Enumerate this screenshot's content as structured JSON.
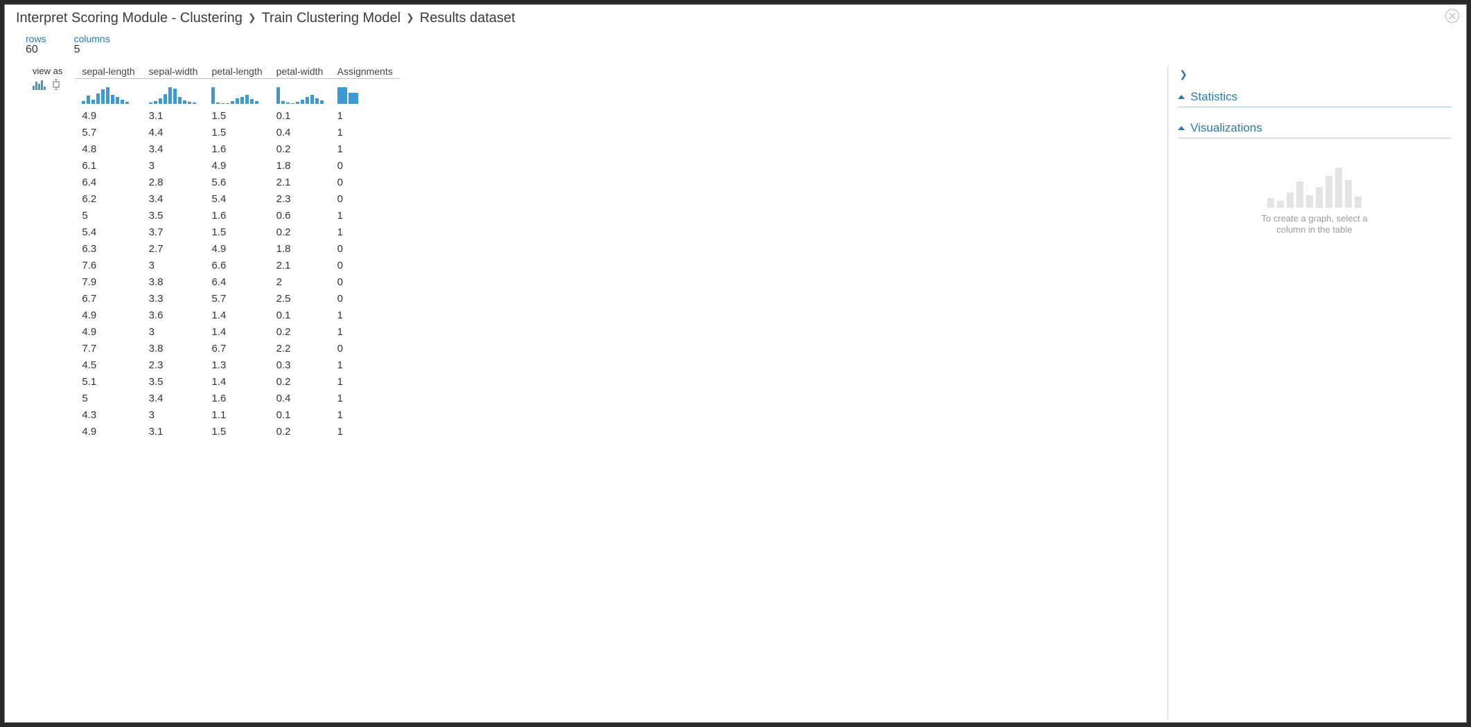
{
  "breadcrumb": {
    "level1": "Interpret Scoring Module - Clustering",
    "level2": "Train Clustering Model",
    "level3": "Results dataset"
  },
  "meta": {
    "rows_label": "rows",
    "rows_value": "60",
    "columns_label": "columns",
    "columns_value": "5"
  },
  "viewas": {
    "label": "view as"
  },
  "table": {
    "columns": [
      "sepal-length",
      "sepal-width",
      "petal-length",
      "petal-width",
      "Assignments"
    ],
    "histograms": [
      [
        4,
        12,
        6,
        16,
        22,
        25,
        14,
        10,
        6,
        3
      ],
      [
        2,
        4,
        8,
        14,
        24,
        22,
        10,
        5,
        3,
        2
      ],
      [
        25,
        2,
        1,
        0,
        4,
        8,
        10,
        14,
        7,
        4
      ],
      [
        25,
        4,
        2,
        0,
        3,
        6,
        10,
        14,
        8,
        5
      ],
      [
        60,
        40
      ]
    ],
    "rows": [
      [
        "4.9",
        "3.1",
        "1.5",
        "0.1",
        "1"
      ],
      [
        "5.7",
        "4.4",
        "1.5",
        "0.4",
        "1"
      ],
      [
        "4.8",
        "3.4",
        "1.6",
        "0.2",
        "1"
      ],
      [
        "6.1",
        "3",
        "4.9",
        "1.8",
        "0"
      ],
      [
        "6.4",
        "2.8",
        "5.6",
        "2.1",
        "0"
      ],
      [
        "6.2",
        "3.4",
        "5.4",
        "2.3",
        "0"
      ],
      [
        "5",
        "3.5",
        "1.6",
        "0.6",
        "1"
      ],
      [
        "5.4",
        "3.7",
        "1.5",
        "0.2",
        "1"
      ],
      [
        "6.3",
        "2.7",
        "4.9",
        "1.8",
        "0"
      ],
      [
        "7.6",
        "3",
        "6.6",
        "2.1",
        "0"
      ],
      [
        "7.9",
        "3.8",
        "6.4",
        "2",
        "0"
      ],
      [
        "6.7",
        "3.3",
        "5.7",
        "2.5",
        "0"
      ],
      [
        "4.9",
        "3.6",
        "1.4",
        "0.1",
        "1"
      ],
      [
        "4.9",
        "3",
        "1.4",
        "0.2",
        "1"
      ],
      [
        "7.7",
        "3.8",
        "6.7",
        "2.2",
        "0"
      ],
      [
        "4.5",
        "2.3",
        "1.3",
        "0.3",
        "1"
      ],
      [
        "5.1",
        "3.5",
        "1.4",
        "0.2",
        "1"
      ],
      [
        "5",
        "3.4",
        "1.6",
        "0.4",
        "1"
      ],
      [
        "4.3",
        "3",
        "1.1",
        "0.1",
        "1"
      ],
      [
        "4.9",
        "3.1",
        "1.5",
        "0.2",
        "1"
      ]
    ]
  },
  "rightpane": {
    "statistics_label": "Statistics",
    "visualizations_label": "Visualizations",
    "placeholder_line1": "To create a graph, select a",
    "placeholder_line2": "column in the table"
  },
  "chart_data": [
    {
      "type": "bar",
      "title": "sepal-length distribution",
      "values": [
        4,
        12,
        6,
        16,
        22,
        25,
        14,
        10,
        6,
        3
      ]
    },
    {
      "type": "bar",
      "title": "sepal-width distribution",
      "values": [
        2,
        4,
        8,
        14,
        24,
        22,
        10,
        5,
        3,
        2
      ]
    },
    {
      "type": "bar",
      "title": "petal-length distribution",
      "values": [
        25,
        2,
        1,
        0,
        4,
        8,
        10,
        14,
        7,
        4
      ]
    },
    {
      "type": "bar",
      "title": "petal-width distribution",
      "values": [
        25,
        4,
        2,
        0,
        3,
        6,
        10,
        14,
        8,
        5
      ]
    },
    {
      "type": "bar",
      "title": "Assignments distribution",
      "categories": [
        "0",
        "1"
      ],
      "values": [
        60,
        40
      ]
    }
  ]
}
